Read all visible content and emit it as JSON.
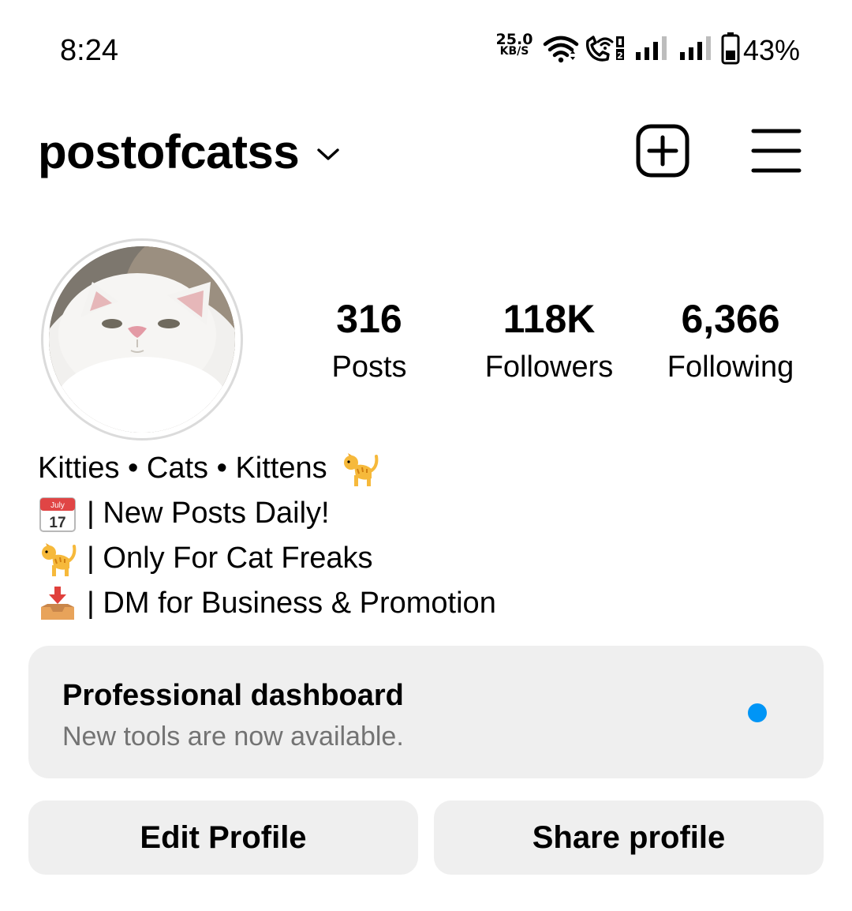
{
  "status_bar": {
    "time": "8:24",
    "net_speed_value": "25.0",
    "net_speed_unit": "KB/S",
    "battery_percent": "43%"
  },
  "header": {
    "username": "postofcatss",
    "icons": [
      "chevron-down-icon",
      "new-post-icon",
      "menu-icon"
    ]
  },
  "profile": {
    "stats": [
      {
        "value": "316",
        "label": "Posts"
      },
      {
        "value": "118K",
        "label": "Followers"
      },
      {
        "value": "6,366",
        "label": "Following"
      }
    ]
  },
  "bio": {
    "line1": "Kitties • Cats • Kittens",
    "line2": "| New Posts Daily!",
    "line3": "| Only For Cat Freaks",
    "line4": "| DM for Business & Promotion",
    "calendar_month": "July",
    "calendar_day": "17"
  },
  "dashboard": {
    "title": "Professional dashboard",
    "subtitle": "New tools are now available.",
    "dot_color": "#0095f6"
  },
  "buttons": {
    "edit_profile": "Edit Profile",
    "share_profile": "Share profile"
  }
}
